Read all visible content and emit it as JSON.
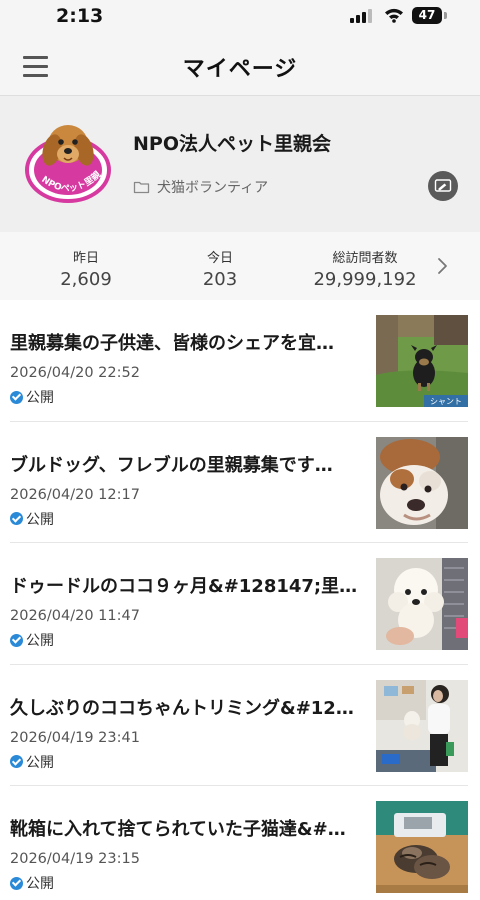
{
  "status_bar": {
    "time": "2:13",
    "battery": "47"
  },
  "header": {
    "title": "マイページ"
  },
  "profile": {
    "name": "NPO法人ペット里親会",
    "category": "犬猫ボランティア",
    "logo_text": "NPOペット里親会"
  },
  "stats": {
    "yesterday_label": "昨日",
    "yesterday_value": "2,609",
    "today_label": "今日",
    "today_value": "203",
    "total_label": "総訪問者数",
    "total_value": "29,999,192"
  },
  "posts": [
    {
      "title": "里親募集の子供達、皆様のシェアを宜…",
      "date": "2026/04/20 22:52",
      "status": "公開",
      "thumb_caption": "シャント",
      "thumb_icon": "puppy-on-grass-photo"
    },
    {
      "title": "ブルドッグ、フレブルの里親募集です…",
      "date": "2026/04/20 12:17",
      "status": "公開",
      "thumb_icon": "bulldog-photo"
    },
    {
      "title": "ドゥードルのココ９ヶ月&#128147;里…",
      "date": "2026/04/20 11:47",
      "status": "公開",
      "thumb_icon": "white-doodle-photo"
    },
    {
      "title": "久しぶりのココちゃんトリミング&#12…",
      "date": "2026/04/19 23:41",
      "status": "公開",
      "thumb_icon": "grooming-photo"
    },
    {
      "title": "靴箱に入れて捨てられていた子猫達&#…",
      "date": "2026/04/19 23:15",
      "status": "公開",
      "thumb_icon": "kittens-on-scale-photo"
    }
  ],
  "colors": {
    "accent": "#2a8ad8",
    "logo_ring": "#d63aa0"
  }
}
